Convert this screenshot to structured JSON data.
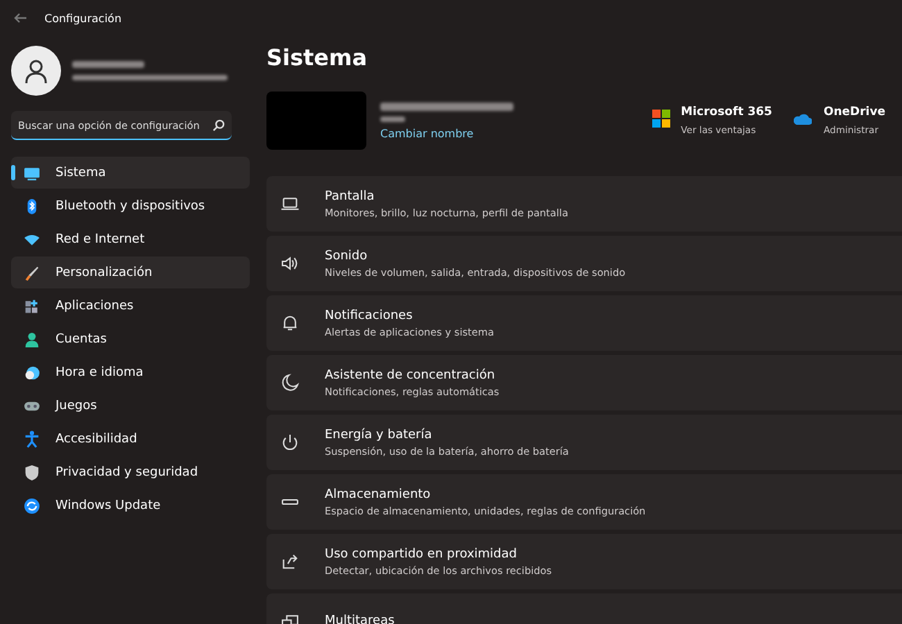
{
  "window": {
    "title": "Configuración"
  },
  "search": {
    "placeholder": "Buscar una opción de configuración"
  },
  "sidebar": {
    "items": [
      {
        "label": "Sistema",
        "selected": true,
        "hovered": false
      },
      {
        "label": "Bluetooth y dispositivos",
        "selected": false,
        "hovered": false
      },
      {
        "label": "Red e Internet",
        "selected": false,
        "hovered": false
      },
      {
        "label": "Personalización",
        "selected": false,
        "hovered": true
      },
      {
        "label": "Aplicaciones",
        "selected": false,
        "hovered": false
      },
      {
        "label": "Cuentas",
        "selected": false,
        "hovered": false
      },
      {
        "label": "Hora e idioma",
        "selected": false,
        "hovered": false
      },
      {
        "label": "Juegos",
        "selected": false,
        "hovered": false
      },
      {
        "label": "Accesibilidad",
        "selected": false,
        "hovered": false
      },
      {
        "label": "Privacidad y seguridad",
        "selected": false,
        "hovered": false
      },
      {
        "label": "Windows Update",
        "selected": false,
        "hovered": false
      }
    ]
  },
  "page": {
    "title": "Sistema",
    "rename_link": "Cambiar nombre",
    "services": [
      {
        "title": "Microsoft 365",
        "subtitle": "Ver las ventajas"
      },
      {
        "title": "OneDrive",
        "subtitle": "Administrar"
      }
    ],
    "settings": [
      {
        "title": "Pantalla",
        "subtitle": "Monitores, brillo, luz nocturna, perfil de pantalla"
      },
      {
        "title": "Sonido",
        "subtitle": "Niveles de volumen, salida, entrada, dispositivos de sonido"
      },
      {
        "title": "Notificaciones",
        "subtitle": "Alertas de aplicaciones y sistema"
      },
      {
        "title": "Asistente de concentración",
        "subtitle": "Notificaciones, reglas automáticas"
      },
      {
        "title": "Energía y batería",
        "subtitle": "Suspensión, uso de la batería, ahorro de batería"
      },
      {
        "title": "Almacenamiento",
        "subtitle": "Espacio de almacenamiento, unidades, reglas de configuración"
      },
      {
        "title": "Uso compartido en proximidad",
        "subtitle": "Detectar, ubicación de los archivos recibidos"
      },
      {
        "title": "Multitareas"
      }
    ]
  }
}
